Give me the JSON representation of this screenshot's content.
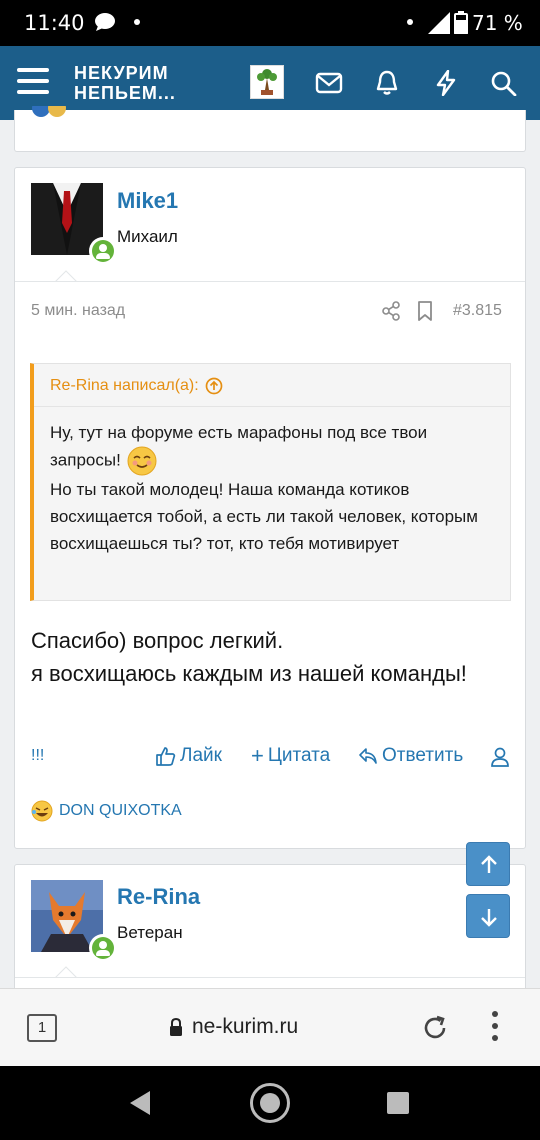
{
  "status_bar": {
    "time": "11:40",
    "battery": "71 %"
  },
  "header": {
    "logo_line1": "НЕКУРИМ",
    "logo_line2": "НЕПЬЕМ..."
  },
  "post": {
    "author": "Mike1",
    "author_title": "Михаил",
    "time": "5 мин. назад",
    "number": "#3.815",
    "quote": {
      "author_label": "Re-Rina написал(а):",
      "line1": "Ну, тут на форуме есть марафоны под все твои запросы!",
      "line2": "Но ты такой молодец! Наша команда котиков восхищается тобой, а есть ли такой человек, которым восхищаешься ты? тот, кто тебя мотивирует"
    },
    "text_line1": "Спасибо) вопрос легкий.",
    "text_line2": "я восхищаюсь каждым из нашей команды!",
    "actions": {
      "report": "!!!",
      "like": "Лайк",
      "quote": "Цитата",
      "reply": "Ответить"
    },
    "reaction_user": "DON QUIXOTKA"
  },
  "next_post": {
    "author": "Re-Rina",
    "author_title": "Ветеран"
  },
  "browser": {
    "tabs": "1",
    "url": "ne-kurim.ru"
  },
  "colors": {
    "header": "#1c5e8a",
    "link": "#2577b1",
    "quote_accent": "#f29d1c",
    "online": "#63b33a"
  }
}
